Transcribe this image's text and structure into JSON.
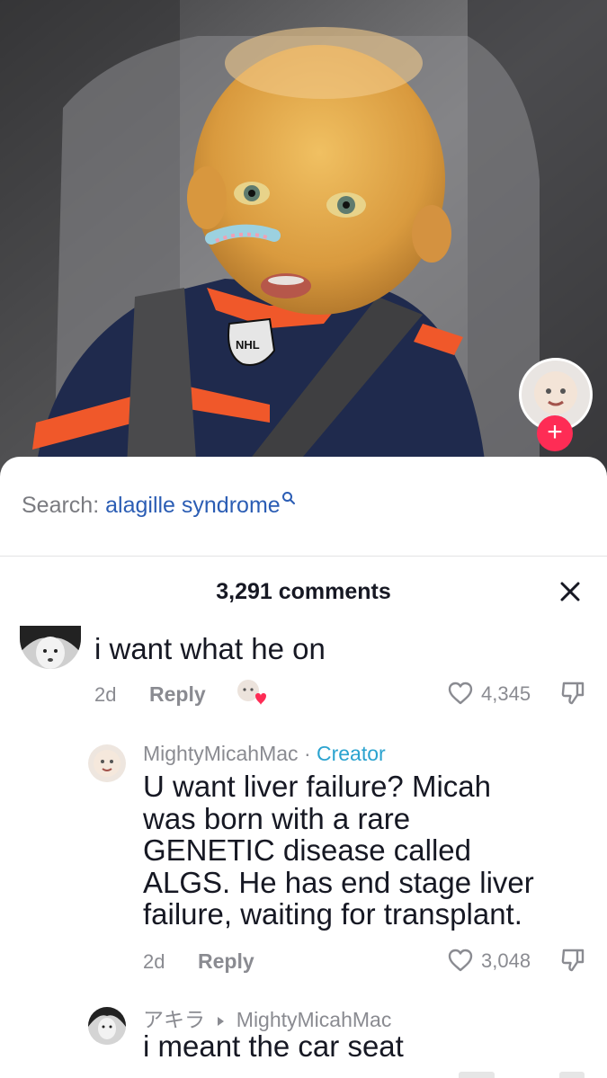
{
  "video": {
    "logo_text": "NHL"
  },
  "search": {
    "prefix": "Search:",
    "term": "alagille syndrome"
  },
  "comments_header": {
    "count_label": "3,291 comments"
  },
  "comments": [
    {
      "text": "i want what he on",
      "age": "2d",
      "reply_label": "Reply",
      "likes": "4,345"
    },
    {
      "username": "MightyMicahMac",
      "separator": "·",
      "badge": "Creator",
      "text_lines": [
        "U want liver failure? Micah",
        "was born with a rare",
        "GENETIC disease called",
        "ALGS. He has end stage liver",
        "failure, waiting for transplant."
      ],
      "age": "2d",
      "reply_label": "Reply",
      "likes": "3,048"
    },
    {
      "username": "アキラ",
      "reply_to": "MightyMicahMac",
      "text": "i meant the car seat"
    }
  ],
  "colors": {
    "accent_pink": "#fe2c55",
    "search_blue": "#2b5db4",
    "creator_blue": "#2ba3cf",
    "muted_gray": "#8a8b91"
  },
  "icons": [
    "search-icon",
    "close-icon",
    "heart-icon",
    "dislike-icon",
    "plus-icon"
  ]
}
